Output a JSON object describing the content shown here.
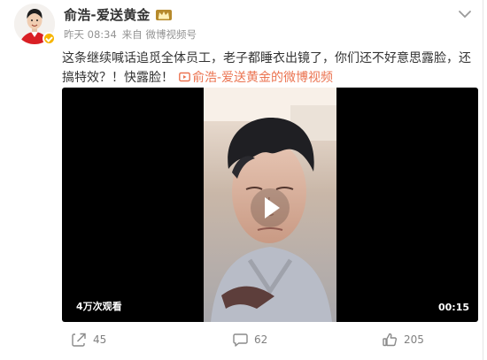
{
  "post": {
    "username": "俞浩-爱送黄金",
    "time": "昨天 08:34",
    "source": "来自 微博视频号",
    "text": "这条继续喊话追觅全体员工，老子都睡衣出镜了，你们还不好意思露脸，还搞特效？！快露脸！",
    "video_link_label": "俞浩-爱送黄金的微博视频"
  },
  "video": {
    "views": "4万次观看",
    "duration": "00:15"
  },
  "actions": {
    "share_count": "45",
    "comment_count": "62",
    "like_count": "205"
  },
  "icons": {
    "avatar": "avatar",
    "verified": "verified-badge-icon",
    "crown": "crown-icon",
    "more": "chevron-down-icon",
    "link": "video-link-icon",
    "play": "play-icon",
    "share": "share-icon",
    "comment": "comment-icon",
    "like": "thumbs-up-icon"
  },
  "colors": {
    "text": "#333333",
    "meta": "#939393",
    "link": "#eb7350",
    "badge": "#f7b500",
    "video_bg": "#000000",
    "action": "#808080"
  }
}
